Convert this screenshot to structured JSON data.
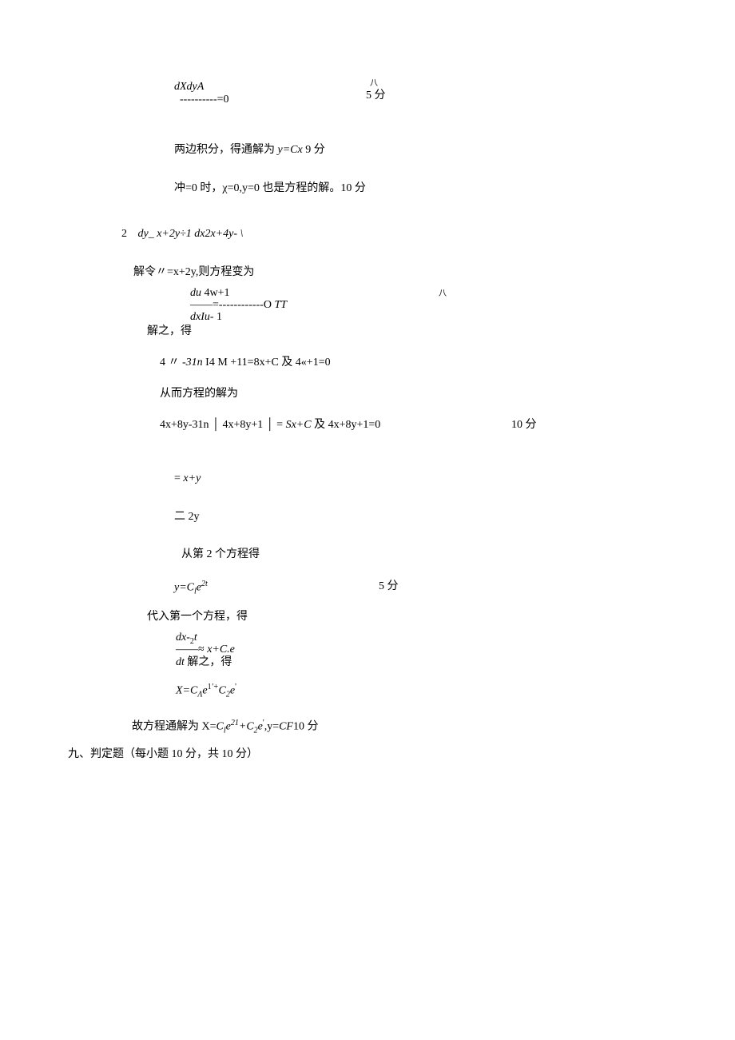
{
  "lines": {
    "l1": "dXdyA",
    "l2": "八",
    "l3": "----------=0",
    "l4": "5 分",
    "l5": "两边积分，得通解为",
    "l5b": "y=Cx",
    "l5c": "9 分",
    "l6": "冲=0 时，χ=0,y=0 也是方程的解。10 分",
    "l7a": "2",
    "l7b": "dy_ x+2y÷1",
    "l7c": "dx2x+4y- \\",
    "l8": "解令〃=x+2y,则方程变为",
    "l9a": "du",
    "l9b": "4w+1",
    "l10": "八",
    "l11a": "——=------------O",
    "l11b": "TT",
    "l12a": "dxIu-",
    "l12b": "1",
    "l13": "解之，得",
    "l14a": "4 〃",
    "l14b": "-31n",
    "l14c": "I4",
    "l14d": "M",
    "l14e": "+11=8x+C 及 4«+1=0",
    "l15": "从而方程的解为",
    "l16a": "4x+8y-31n │ 4x+8y+1 │ =",
    "l16b": "Sx+C",
    "l16c": " 及 4x+8y+1=0",
    "l16d": "10 分",
    "l17a": "=",
    "l17b": "x+y",
    "l18": "二 2y",
    "l19": "从第 2 个方程得",
    "l20a": "y=C",
    "l20sub": "l",
    "l20b": "e",
    "l20sup": "2t",
    "l20c": "5 分",
    "l21": "代入第一个方程，得",
    "l22a": "dx-",
    "l22sub": "2",
    "l22b": "t",
    "l23a": "——≈",
    "l23b": "x+C.e",
    "l24a": "dt",
    "l24b": "解之，得",
    "l25a": "X=C",
    "l25sub1": "Λ",
    "l25b": "e",
    "l25sup1": "1",
    "l25sup1b": "'+",
    "l25c": "C",
    "l25sub2": "2",
    "l25d": "e",
    "l25sup2": "'",
    "l26a": "故方程通解为 X=",
    "l26b": "C",
    "l26sub1": "l",
    "l26c": "e",
    "l26sup1": "21",
    "l26d": "+",
    "l26e": "C",
    "l26sub2": "2",
    "l26f": "e",
    "l26sup2": "'",
    "l26g": ",y=",
    "l26h": "CF",
    "l26i": "10 分",
    "l27": "九、判定题（每小题 10 分，共 10 分）"
  }
}
